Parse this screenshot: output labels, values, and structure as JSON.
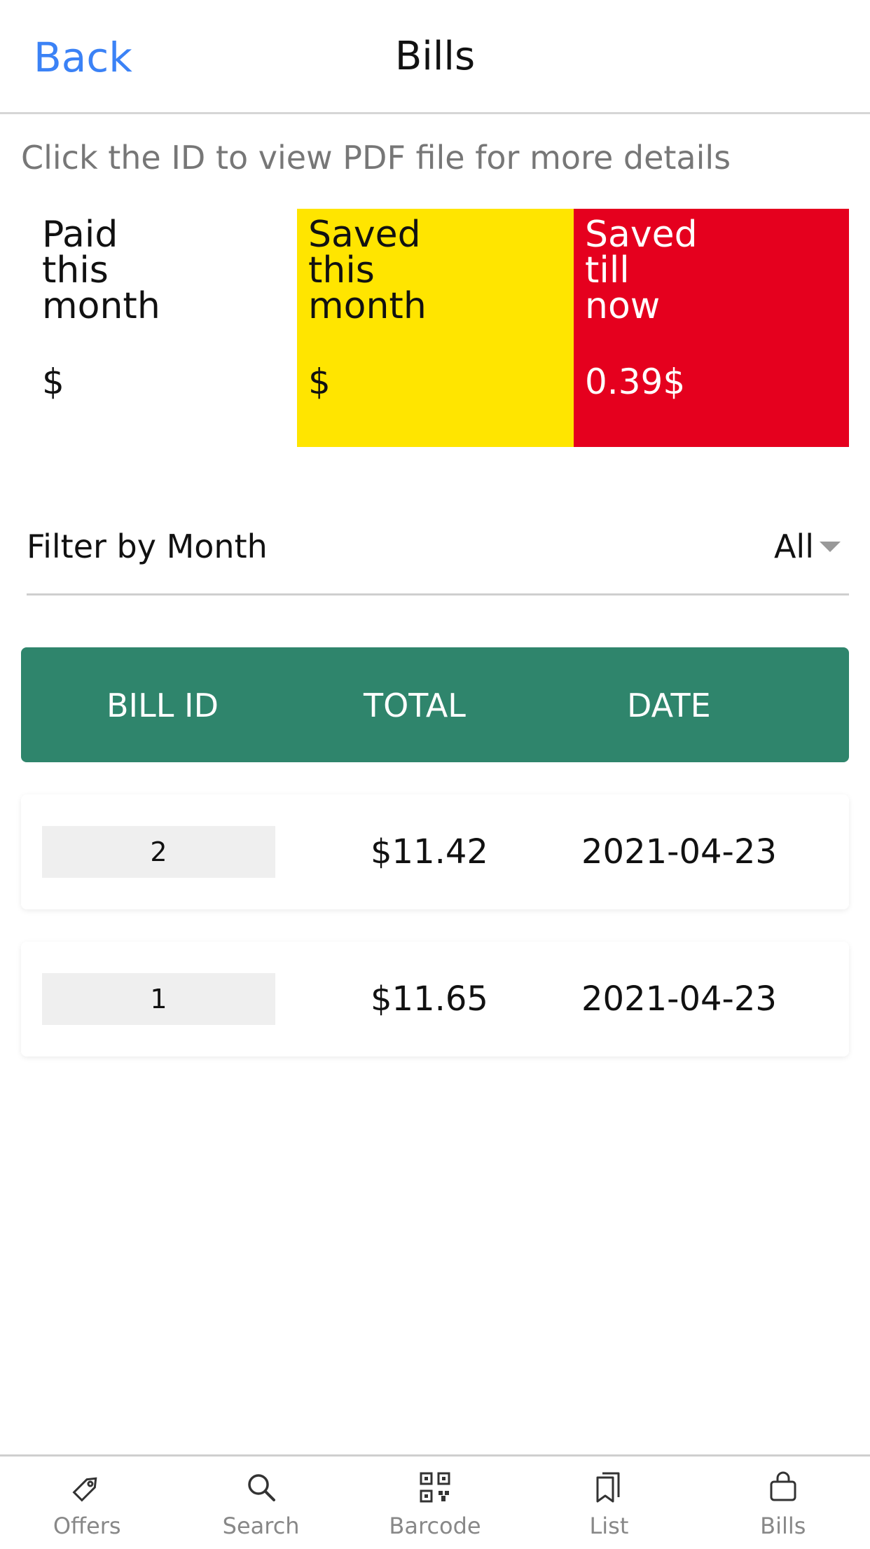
{
  "header": {
    "back_label": "Back",
    "title": "Bills"
  },
  "hint": "Click the ID to view PDF file for more details",
  "stats": {
    "paid": {
      "label": "Paid\nthis\nmonth",
      "value": "$"
    },
    "saved_month": {
      "label": "Saved\nthis\nmonth",
      "value": "$"
    },
    "saved_total": {
      "label": "Saved\ntill\nnow",
      "value": "0.39$"
    }
  },
  "filter": {
    "label": "Filter by Month",
    "selected": "All"
  },
  "table": {
    "headers": [
      "BILL ID",
      "TOTAL",
      "DATE"
    ],
    "rows": [
      {
        "id": "2",
        "total": "$11.42",
        "date": "2021-04-23"
      },
      {
        "id": "1",
        "total": "$11.65",
        "date": "2021-04-23"
      }
    ]
  },
  "tabs": [
    {
      "label": "Offers",
      "icon": "tag-icon"
    },
    {
      "label": "Search",
      "icon": "search-icon"
    },
    {
      "label": "Barcode",
      "icon": "qr-code-icon"
    },
    {
      "label": "List",
      "icon": "bookmarks-icon"
    },
    {
      "label": "Bills",
      "icon": "shopping-bag-icon"
    }
  ],
  "colors": {
    "accent": "#3b82f6",
    "saved_month_bg": "#ffe500",
    "saved_total_bg": "#e5001e",
    "table_header_bg": "#2f856c"
  }
}
